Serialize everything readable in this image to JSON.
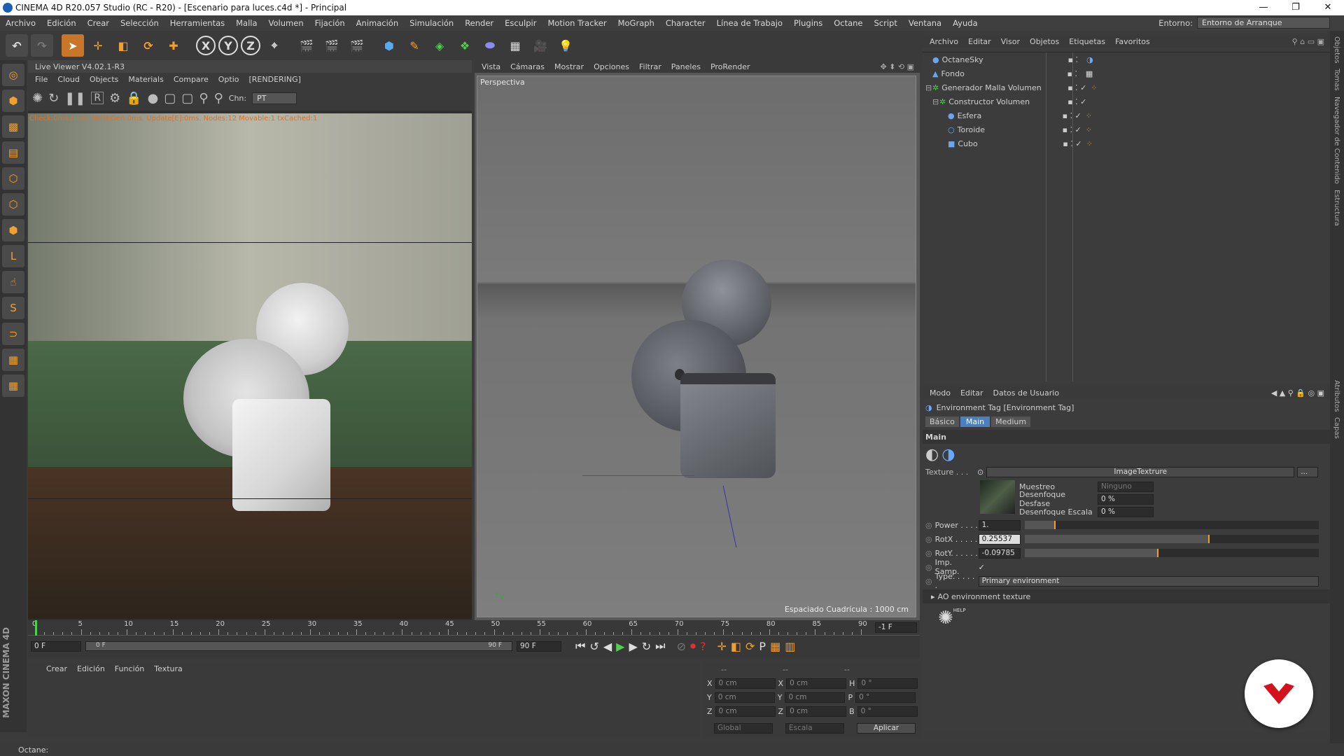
{
  "titlebar": {
    "title": "CINEMA 4D R20.057 Studio (RC - R20) - [Escenario para luces.c4d *] - Principal"
  },
  "menu": [
    "Archivo",
    "Edición",
    "Crear",
    "Selección",
    "Herramientas",
    "Malla",
    "Volumen",
    "Fijación",
    "Animación",
    "Simulación",
    "Render",
    "Esculpir",
    "Motion Tracker",
    "MoGraph",
    "Character",
    "Línea de Trabajo",
    "Plugins",
    "Octane",
    "Script",
    "Ventana",
    "Ayuda"
  ],
  "environment": {
    "label": "Entorno:",
    "value": "Entorno de Arranque"
  },
  "live_viewer": {
    "title": "Live Viewer V4.02.1-R3",
    "menu": [
      "File",
      "Cloud",
      "Objects",
      "Materials",
      "Compare",
      "Optio"
    ],
    "state": "[RENDERING]",
    "chn_label": "Chn:",
    "chn_value": "PT",
    "status": "Check:0ms./1ms. MeshGen:0ms. Update[E]:0ms. Nodes:12 Movable:1 txCached:1"
  },
  "viewport": {
    "menu": [
      "Vista",
      "Cámaras",
      "Mostrar",
      "Opciones",
      "Filtrar",
      "Paneles",
      "ProRender"
    ],
    "label": "Perspectiva",
    "grid": "Espaciado Cuadrícula : 1000 cm"
  },
  "object_manager": {
    "menu": [
      "Archivo",
      "Editar",
      "Visor",
      "Objetos",
      "Etiquetas",
      "Favoritos"
    ],
    "objects": [
      {
        "name": "OctaneSky",
        "indent": 0
      },
      {
        "name": "Fondo",
        "indent": 0
      },
      {
        "name": "Generador Malla Volumen",
        "indent": 0
      },
      {
        "name": "Constructor Volumen",
        "indent": 1
      },
      {
        "name": "Esfera",
        "indent": 2
      },
      {
        "name": "Toroide",
        "indent": 2
      },
      {
        "name": "Cubo",
        "indent": 2
      }
    ]
  },
  "attributes": {
    "menu": [
      "Modo",
      "Editar",
      "Datos de Usuario"
    ],
    "tag_title": "Environment Tag [Environment Tag]",
    "tabs": [
      "Básico",
      "Main",
      "Medium"
    ],
    "active_tab": "Main",
    "section": "Main",
    "texture_label": "Texture . . .",
    "texture_value": "ImageTextrure",
    "texture_more": "...",
    "muestreo_label": "Muestreo",
    "muestreo_value": "Ninguno",
    "desf_label": "Desenfoque Desfase",
    "desf_value": "0 %",
    "esc_label": "Desenfoque Escala",
    "esc_value": "0 %",
    "power_label": "Power . . . .",
    "power_value": "1.",
    "power_slider": 0.1,
    "rotx_label": "RotX . . . . .",
    "rotx_value": "0.25537",
    "rotx_slider": 0.625,
    "roty_label": "RotY. . . . . .",
    "roty_value": "-0.09785",
    "roty_slider": 0.45,
    "imp_label": "Imp. Samp.",
    "imp_check": "✓",
    "type_label": "Type. . . . . .",
    "type_value": "Primary environment",
    "ao_label": "AO environment texture",
    "help": "HELP"
  },
  "timeline": {
    "ticks": [
      "0",
      "5",
      "10",
      "15",
      "20",
      "25",
      "30",
      "35",
      "40",
      "45",
      "50",
      "55",
      "60",
      "65",
      "70",
      "75",
      "80",
      "85",
      "90"
    ],
    "end_field": "-1 F",
    "start": "0 F",
    "range_start": "0 F",
    "range_end": "90 F",
    "end": "90 F"
  },
  "material_manager": {
    "menu": [
      "Crear",
      "Edición",
      "Función",
      "Textura"
    ]
  },
  "coords": {
    "header1": "--",
    "header2": "--",
    "header3": "--",
    "rows": [
      {
        "a": "X",
        "av": "0 cm",
        "b": "X",
        "bv": "0 cm",
        "c": "H",
        "cv": "0 °"
      },
      {
        "a": "Y",
        "av": "0 cm",
        "b": "Y",
        "bv": "0 cm",
        "c": "P",
        "cv": "0 °"
      },
      {
        "a": "Z",
        "av": "0 cm",
        "b": "Z",
        "bv": "0 cm",
        "c": "B",
        "cv": "0 °"
      }
    ],
    "mode1": "Global",
    "mode2": "Escala",
    "apply": "Aplicar"
  },
  "status": "Octane:",
  "right_tabs": [
    "Objetos",
    "Tomas",
    "Navegador de Contenido",
    "Estructura"
  ],
  "right_tabs2": [
    "Atributos",
    "Capas"
  ],
  "brand": "MAXON CINEMA 4D"
}
